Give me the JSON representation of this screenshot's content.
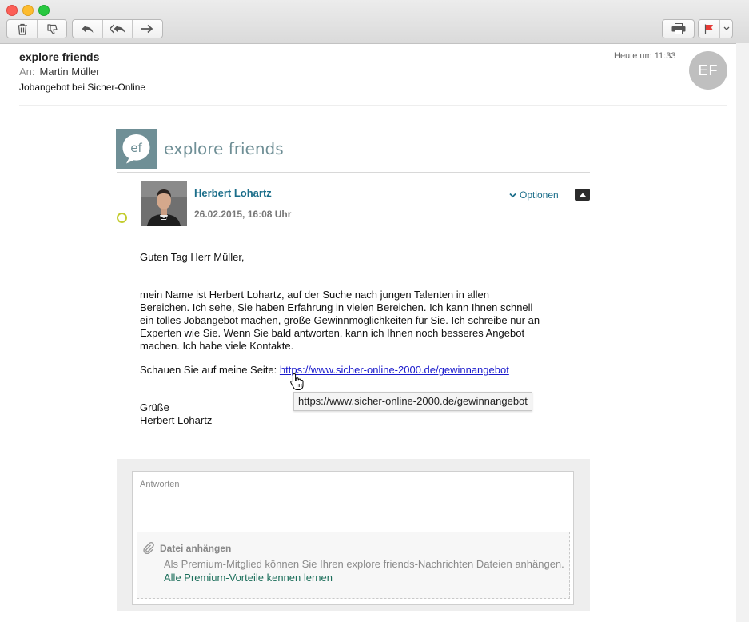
{
  "toolbar": {
    "buttons": [
      "trash-icon",
      "junk-icon",
      "reply-icon",
      "reply-all-icon",
      "forward-icon",
      "print-icon",
      "flag-icon"
    ],
    "flag_color": "#e53b36"
  },
  "header": {
    "sender": "explore friends",
    "to_label": "An:",
    "to_name": "Martin Müller",
    "subject": "Jobangebot bei Sicher-Online",
    "date": "Heute um 11:33",
    "avatar_initials": "EF"
  },
  "brand": {
    "logo_initials": "ef",
    "name": "explore friends",
    "color": "#6f8f96"
  },
  "message": {
    "author": "Herbert Lohartz",
    "date": "26.02.2015, 16:08 Uhr",
    "options_label": "Optionen",
    "greeting": "Guten Tag Herr Müller,",
    "paragraph_lines": [
      "mein Name ist Herbert Lohartz, auf der Suche nach jungen Talenten in allen",
      "Bereichen. Ich sehe, Sie haben Erfahrung in vielen Bereichen. Ich kann Ihnen schnell",
      "ein tolles Jobangebot machen, große Gewinnmöglichkeiten für Sie. Ich schreibe nur an",
      "Experten wie Sie. Wenn Sie bald antworten, kann ich Ihnen noch besseres Angebot",
      "machen. Ich habe viele Kontakte."
    ],
    "link_prefix": "Schauen Sie auf meine Seite:",
    "link_url": "https://www.sicher-online-2000.de/gewinnangebot",
    "tooltip_url": "https://www.sicher-online-2000.de/gewinnangebot",
    "closing": "Grüße",
    "signature": "Herbert Lohartz"
  },
  "reply": {
    "label": "Antworten",
    "attach_title": "Datei anhängen",
    "attach_desc": "Als Premium-Mitglied können Sie Ihren explore friends-Nachrichten Dateien anhängen.",
    "attach_link": "Alle Premium-Vorteile kennen lernen"
  }
}
